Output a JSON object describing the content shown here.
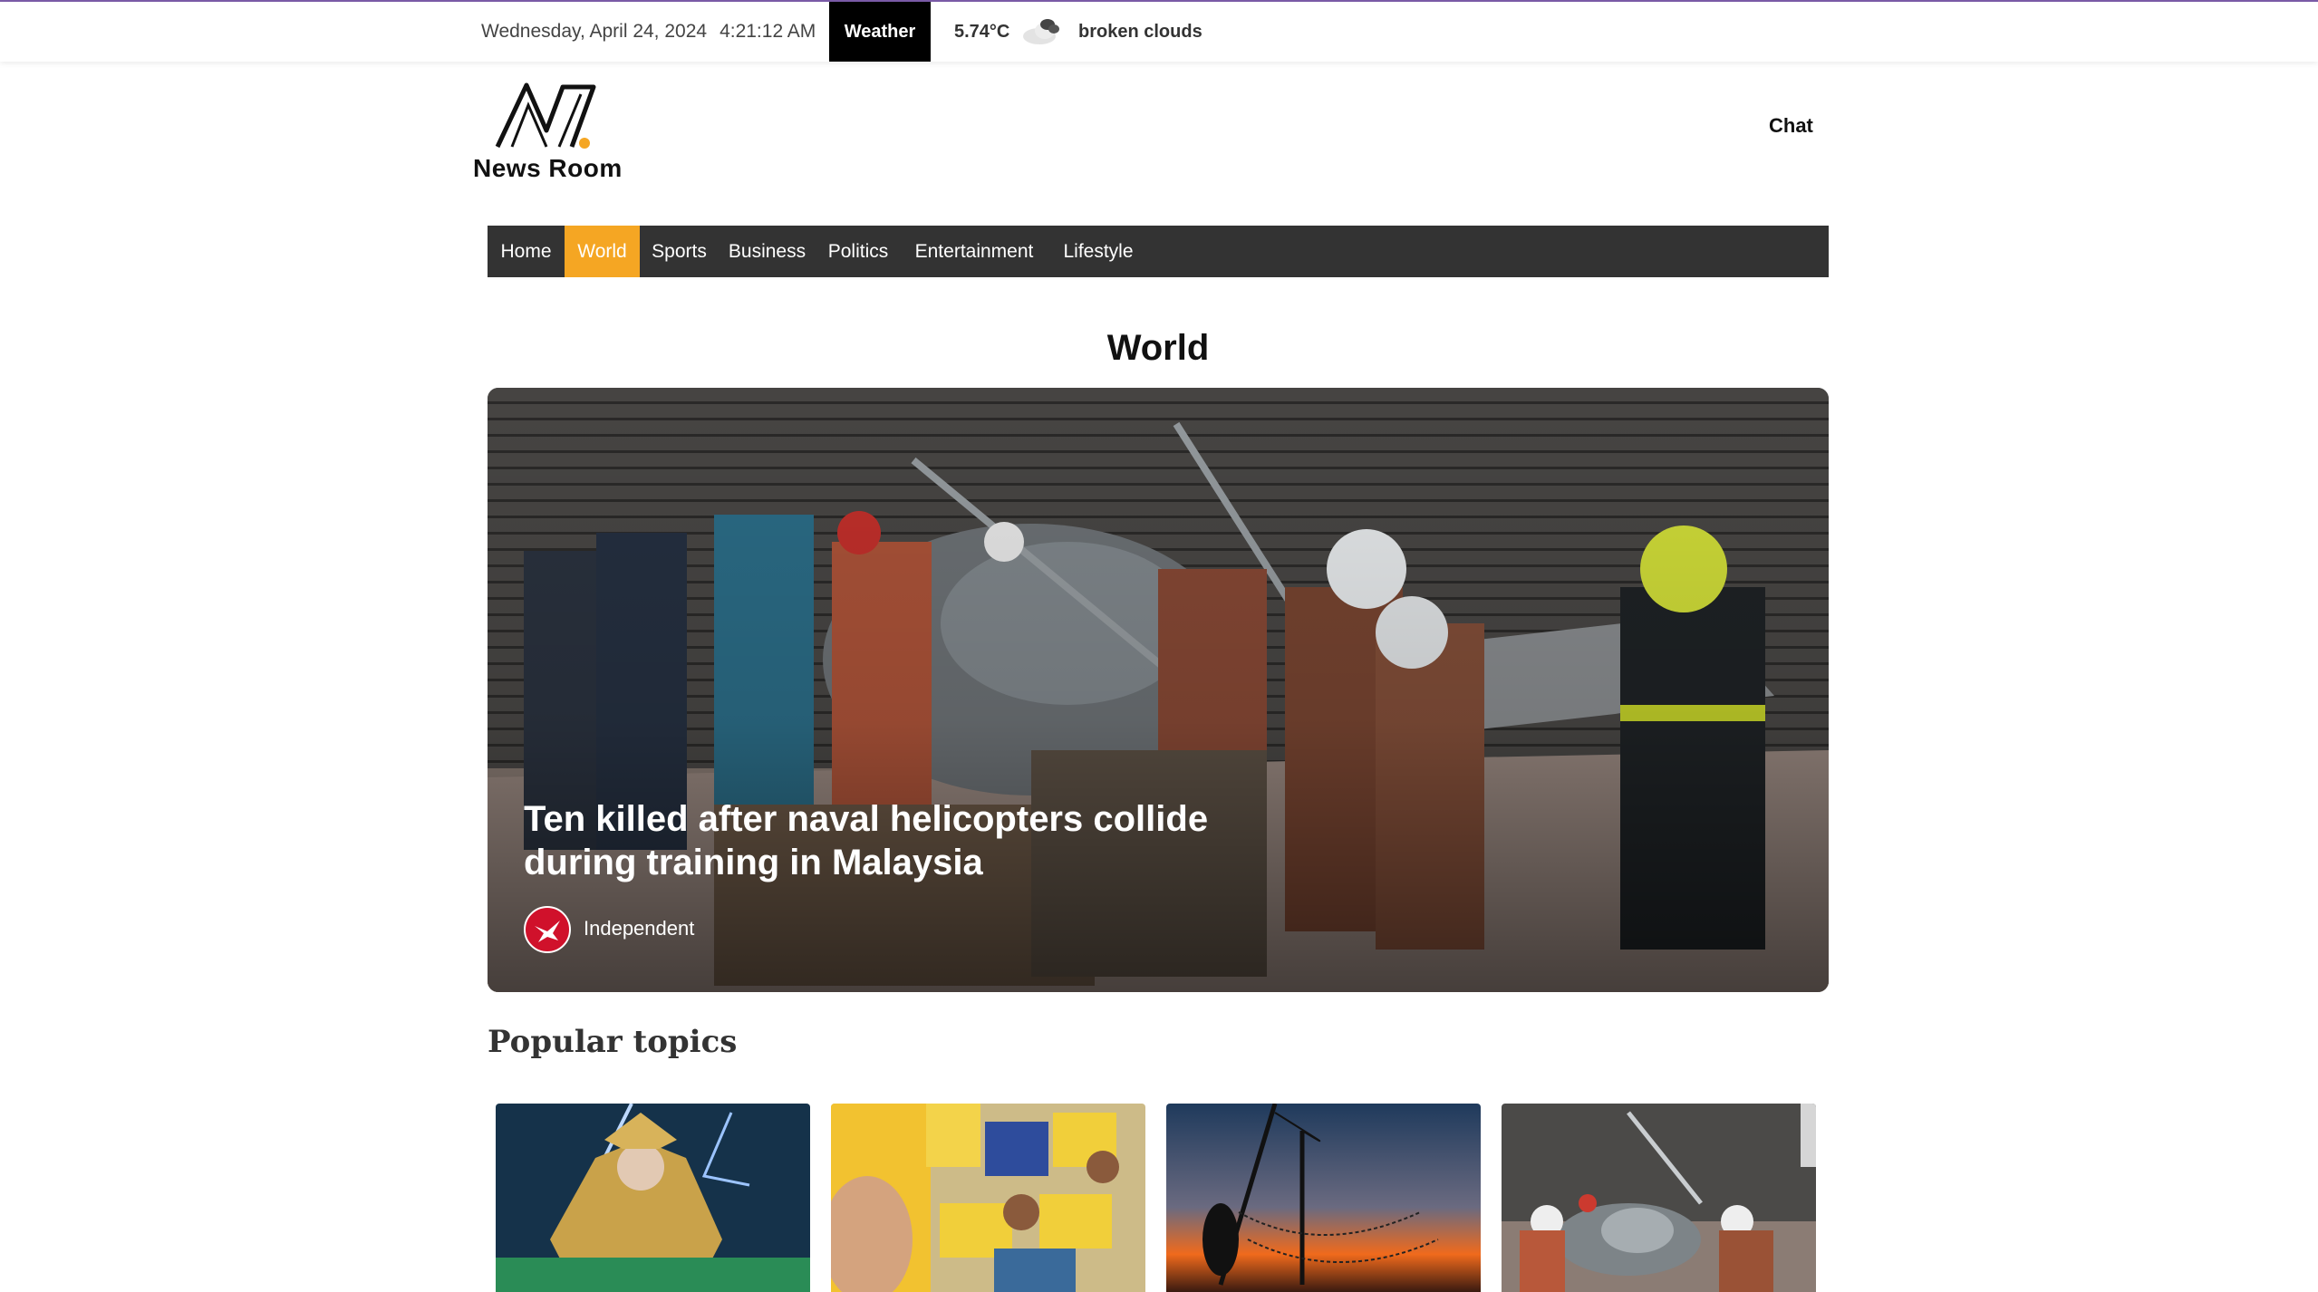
{
  "topbar": {
    "date": "Wednesday, April 24, 2024",
    "time": "4:21:12 AM",
    "weather_label": "Weather",
    "temperature": "5.74°C",
    "condition": "broken clouds",
    "condition_icon": "broken-clouds-icon"
  },
  "header": {
    "brand_name": "News Room",
    "logo_icon": "newsroom-logo",
    "chat_label": "Chat"
  },
  "nav": {
    "items": [
      {
        "label": "Home",
        "active": false
      },
      {
        "label": "World",
        "active": true
      },
      {
        "label": "Sports",
        "active": false
      },
      {
        "label": "Business",
        "active": false
      },
      {
        "label": "Politics",
        "active": false
      },
      {
        "label": "Entertainment",
        "active": false
      },
      {
        "label": "Lifestyle",
        "active": false
      }
    ]
  },
  "main": {
    "section_title": "World",
    "hero": {
      "headline": "Ten killed after naval helicopters collide during training in Malaysia",
      "source": "Independent",
      "source_icon": "independent-eagle-icon"
    },
    "popular": {
      "title": "Popular topics",
      "cards": [
        {
          "image": "drag-performer-costume"
        },
        {
          "image": "protest-crowd-posters"
        },
        {
          "image": "fishing-net-sunset"
        },
        {
          "image": "helicopter-crash-rescue"
        }
      ]
    }
  },
  "colors": {
    "accent": "#f5a623",
    "navbar": "#333333",
    "top_line": "#7b5ca8",
    "source_red": "#d0112b"
  }
}
